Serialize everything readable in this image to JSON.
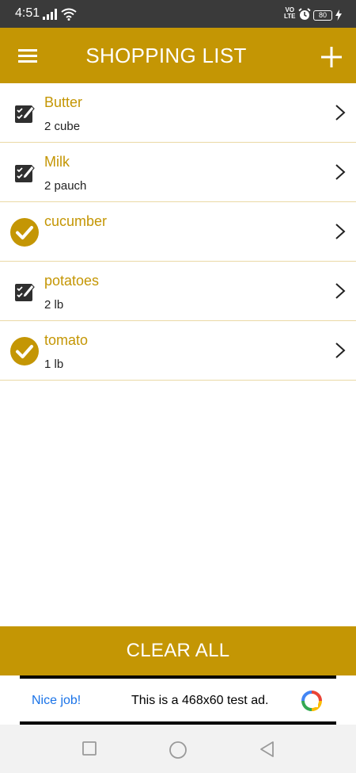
{
  "status_bar": {
    "time": "4:51",
    "volte_top": "VO",
    "volte_bottom": "LTE",
    "battery": "80"
  },
  "app_bar": {
    "title": "SHOPPING LIST",
    "menu_icon": "menu-icon",
    "add_icon": "plus-icon",
    "background": "#c49604"
  },
  "items": [
    {
      "name": "Butter",
      "quantity": "2 cube",
      "state": "pending",
      "icon": "checklist-edit-icon"
    },
    {
      "name": "Milk",
      "quantity": "2 pauch",
      "state": "pending",
      "icon": "checklist-edit-icon"
    },
    {
      "name": "cucumber",
      "quantity": "",
      "state": "done",
      "icon": "check-circle-icon"
    },
    {
      "name": "potatoes",
      "quantity": "2 lb",
      "state": "pending",
      "icon": "checklist-edit-icon"
    },
    {
      "name": "tomato",
      "quantity": "1 lb",
      "state": "done",
      "icon": "check-circle-icon"
    }
  ],
  "clear_all_label": "CLEAR ALL",
  "ad": {
    "nice": "Nice job!",
    "text": "This is a 468x60 test ad."
  },
  "colors": {
    "accent": "#c49604",
    "divider": "#ead9a5",
    "status_bar": "#3a3a3a"
  }
}
